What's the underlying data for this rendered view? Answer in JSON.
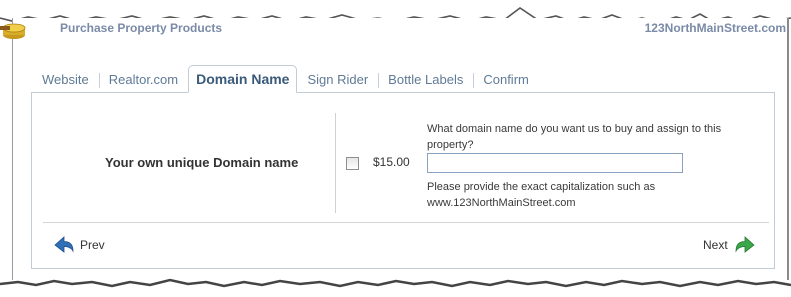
{
  "window": {
    "title_left": "Purchase Property Products",
    "title_right": "123NorthMainStreet.com"
  },
  "tabs": [
    {
      "label": "Website",
      "active": false
    },
    {
      "label": "Realtor.com",
      "active": false
    },
    {
      "label": "Domain Name",
      "active": true
    },
    {
      "label": "Sign Rider",
      "active": false
    },
    {
      "label": "Bottle Labels",
      "active": false
    },
    {
      "label": "Confirm",
      "active": false
    }
  ],
  "form": {
    "row_label": "Your own unique Domain name",
    "checked": false,
    "price": "$15.00",
    "question": "What domain name do you want us to buy and assign to this property?",
    "input_value": "",
    "hint": "Please provide the exact capitalization such as www.123NorthMainStreet.com"
  },
  "nav": {
    "prev_label": "Prev",
    "next_label": "Next"
  },
  "colors": {
    "prev_arrow": "#2f6fb8",
    "next_arrow": "#3aa84a",
    "tab_text": "#5f7a96",
    "tab_active_text": "#3a5a7a"
  },
  "icons": {
    "logo": "coin-stack-icon",
    "prev": "arrow-left-icon",
    "next": "arrow-right-icon"
  }
}
